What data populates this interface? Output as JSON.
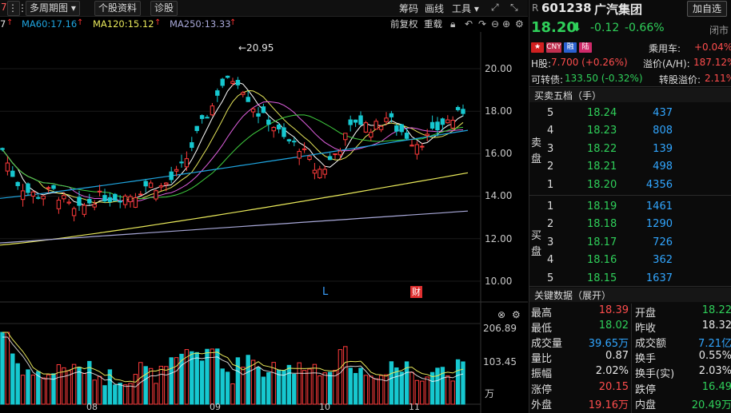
{
  "toolbar": {
    "left_num": "7",
    "multi_period": "多周期图",
    "stock_info": "个股资料",
    "diagnose": "诊股",
    "chips": "筹码",
    "draw_line": "画线",
    "tools": "工具"
  },
  "ma_legend": {
    "ma60": "MA60:17.16",
    "ma120": "MA120:15.12",
    "ma250": "MA250:13.33",
    "colors": {
      "ma60": "#1fa5e0",
      "ma120": "#e8e85a",
      "ma250": "#a8a8d8"
    }
  },
  "chart_tools": {
    "adjust": "前复权",
    "overlay": "重载"
  },
  "price_axis": [
    "20.00",
    "18.00",
    "16.00",
    "14.00",
    "12.00",
    "10.00"
  ],
  "volume_axis": [
    "206.89",
    "103.45",
    "万"
  ],
  "date_axis": [
    "08",
    "09",
    "10",
    "11"
  ],
  "high_marker": "←20.95",
  "event_markers": {
    "l_marker": "L",
    "cai_marker": "财"
  },
  "stock": {
    "market_tag": "R",
    "code": "601238",
    "name": "广汽集团",
    "add_watch": "加自选",
    "price": "18.20",
    "change": "-0.12",
    "change_pct": "-0.66%",
    "status": "闭市",
    "badges": [
      "CNY",
      "融",
      "陆"
    ],
    "sector_label": "乘用车:",
    "sector_value": "+0.04%",
    "h_label": "H股:",
    "h_value": "7.700 (+0.26%)",
    "premium_label": "溢价(A/H):",
    "premium_value": "187.12%",
    "cb_label": "可转债:",
    "cb_value": "133.50 (-0.32%)",
    "cb_premium_label": "转股溢价:",
    "cb_premium_value": "2.11%"
  },
  "order_book": {
    "title": "买卖五档（手）",
    "sell_label": [
      "卖",
      "盘"
    ],
    "buy_label": [
      "买",
      "盘"
    ],
    "sell": [
      {
        "level": "5",
        "price": "18.24",
        "vol": "437"
      },
      {
        "level": "4",
        "price": "18.23",
        "vol": "808"
      },
      {
        "level": "3",
        "price": "18.22",
        "vol": "139"
      },
      {
        "level": "2",
        "price": "18.21",
        "vol": "498"
      },
      {
        "level": "1",
        "price": "18.20",
        "vol": "4356"
      }
    ],
    "buy": [
      {
        "level": "1",
        "price": "18.19",
        "vol": "1461"
      },
      {
        "level": "2",
        "price": "18.18",
        "vol": "1290"
      },
      {
        "level": "3",
        "price": "18.17",
        "vol": "726"
      },
      {
        "level": "4",
        "price": "18.16",
        "vol": "362"
      },
      {
        "level": "5",
        "price": "18.15",
        "vol": "1637"
      }
    ]
  },
  "key_data": {
    "title": "关键数据（展开）",
    "rows": [
      {
        "l1": "最高",
        "v1": "18.39",
        "l2": "开盘",
        "v2": "18.22"
      },
      {
        "l1": "最低",
        "v1": "18.02",
        "l2": "昨收",
        "v2": "18.32"
      },
      {
        "l1": "成交量",
        "v1": "39.65万",
        "l2": "成交额",
        "v2": "7.21亿"
      },
      {
        "l1": "量比",
        "v1": "0.87",
        "l2": "换手",
        "v2": "0.55%"
      },
      {
        "l1": "振幅",
        "v1": "2.02%",
        "l2": "换手(实)",
        "v2": "2.03%"
      },
      {
        "l1": "涨停",
        "v1": "20.15",
        "l2": "跌停",
        "v2": "16.49"
      },
      {
        "l1": "外盘",
        "v1": "19.16万",
        "l2": "内盘",
        "v2": "20.49万"
      }
    ]
  }
}
